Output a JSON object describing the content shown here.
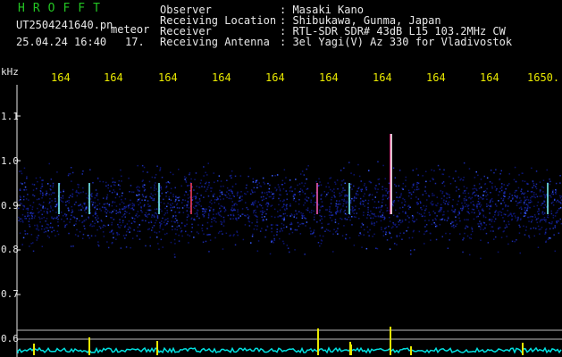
{
  "header": {
    "brand": "HROFFT",
    "filename": "UT2504241640.pn",
    "mode": "meteor",
    "datetime": "25.04.24 16:40",
    "minute": "17.",
    "fields": [
      {
        "label": "Observer",
        "value": ": Masaki Kano"
      },
      {
        "label": "Receiving Location",
        "value": ": Shibukawa, Gunma, Japan"
      },
      {
        "label": "Receiver",
        "value": ": RTL-SDR SDR# 43dB L15 103.2MHz CW"
      },
      {
        "label": "Receiving Antenna",
        "value": ": 3el Yagi(V) Az 330 for Vladivostok"
      }
    ]
  },
  "freq_axis": {
    "unit": "kHz",
    "labels": [
      "164",
      "164",
      "164",
      "164",
      "164",
      "164",
      "164",
      "164",
      "164",
      "1650."
    ]
  },
  "y_axis": {
    "labels": [
      "1.1",
      "1.0",
      "0.9",
      "0.8",
      "0.7",
      "0.6"
    ]
  },
  "colors": {
    "background": "#000000",
    "header_text": "#e8e8e8",
    "brand": "#23c423",
    "tick_text": "#e8e800",
    "noise_blue": "#1a2aa8",
    "spectrum": "#00e0e0",
    "spike": "#e8e800"
  }
}
